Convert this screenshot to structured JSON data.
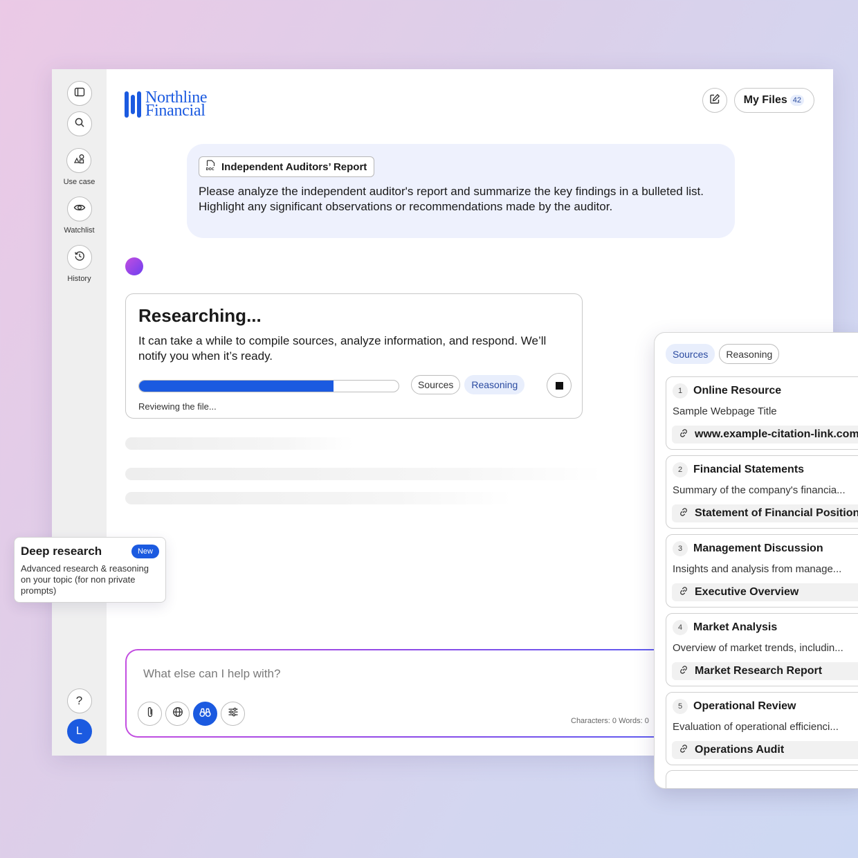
{
  "brand": {
    "name_line1": "Northline",
    "name_line2": "Financial"
  },
  "sidebar": {
    "items": [
      {
        "label": "",
        "icon": "panel-toggle-icon"
      },
      {
        "label": "",
        "icon": "search-icon"
      },
      {
        "label": "Use case",
        "icon": "use-case-icon"
      },
      {
        "label": "Watchlist",
        "icon": "eye-icon"
      },
      {
        "label": "History",
        "icon": "history-icon"
      }
    ],
    "help_label": "?",
    "avatar_initial": "L"
  },
  "header": {
    "my_files_label": "My Files",
    "my_files_count": "42"
  },
  "prompt": {
    "attachment": "Independent Auditors’ Report",
    "text": "Please analyze the independent auditor's report and summarize the key findings in a bulleted list. Highlight any significant observations or recommendations made by the auditor."
  },
  "research": {
    "title": "Researching...",
    "description": "It can take a while to compile sources, analyze information, and respond. We’ll notify you when it’s ready.",
    "progress": 0.75,
    "status": "Reviewing the file...",
    "tabs": [
      "Sources",
      "Reasoning"
    ],
    "active_tab": "Reasoning"
  },
  "composer": {
    "placeholder": "What else can I help with?",
    "counter": "Characters: 0  Words: 0"
  },
  "deep_research": {
    "title": "Deep research",
    "badge": "New",
    "description": "Advanced research & reasoning on your topic (for non private prompts)"
  },
  "sources_panel": {
    "tabs": [
      "Sources",
      "Reasoning"
    ],
    "active_tab": "Sources",
    "items": [
      {
        "num": "1",
        "title": "Online Resource",
        "desc": "Sample Webpage Title",
        "link": "www.example-citation-link.com"
      },
      {
        "num": "2",
        "title": "Financial Statements",
        "desc": "Summary of the company's financia...",
        "link": "Statement of Financial Position"
      },
      {
        "num": "3",
        "title": "Management Discussion",
        "desc": "Insights and analysis from manage...",
        "link": "Executive Overview"
      },
      {
        "num": "4",
        "title": "Market Analysis",
        "desc": "Overview of market trends, includin...",
        "link": "Market Research Report"
      },
      {
        "num": "5",
        "title": "Operational Review",
        "desc": "Evaluation of operational efficienci...",
        "link": "Operations Audit"
      }
    ]
  },
  "colors": {
    "accent": "#1b5ae0",
    "gradient_start": "#c34ee0",
    "gradient_end": "#5b5cf0"
  }
}
